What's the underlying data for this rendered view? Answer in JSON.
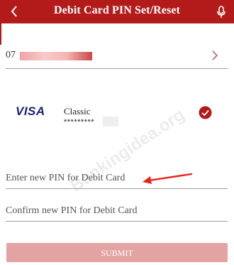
{
  "header": {
    "title": "Debit Card PIN Set/Reset",
    "back_icon": "back-chevron-icon",
    "mic_icon": "microphone-icon",
    "background_color": "#b31b1b"
  },
  "account": {
    "number_prefix": "07",
    "chevron_icon": "chevron-right-icon"
  },
  "card": {
    "brand": "VISA",
    "type": "Classic",
    "number_masked": "*********",
    "selected_icon": "check-circle-icon",
    "selected_color": "#b31b1b"
  },
  "watermark": "Bankingidea.org",
  "form": {
    "new_pin_placeholder": "Enter new PIN for Debit Card",
    "confirm_pin_placeholder": "Confirm new PIN for Debit Card"
  },
  "submit": {
    "label": "SUBMIT",
    "color": "#e3a3a3"
  }
}
